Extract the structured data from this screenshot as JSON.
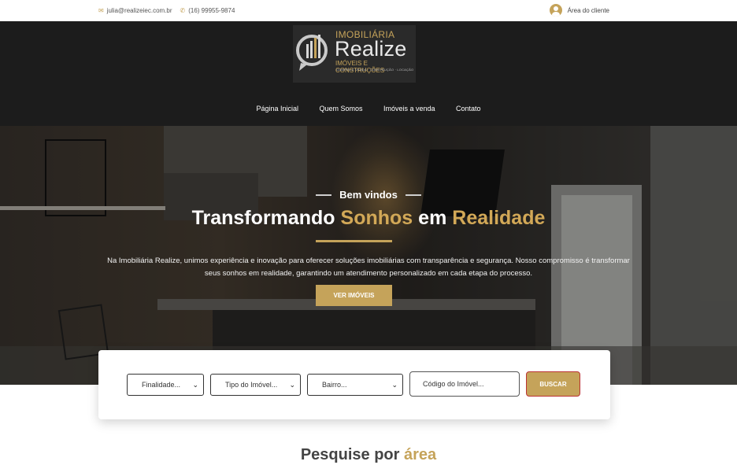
{
  "topbar": {
    "email": "julia@realizeiec.com.br",
    "phone": "(16) 99955-9874",
    "client_area": "Área do cliente"
  },
  "logo": {
    "line1": "IMOBILIÁRIA",
    "line2": "Realize",
    "line3": "IMÓVEIS E CONSTRUÇÕES",
    "line4": "COMPRA E VENDA · CONSTRUÇÃO · LOCAÇÃO"
  },
  "nav": {
    "items": [
      "Página Inicial",
      "Quem Somos",
      "Imóveis a venda",
      "Contato"
    ]
  },
  "hero": {
    "welcome": "Bem vindos",
    "headline_part1": "Transformando",
    "headline_gold1": "Sonhos",
    "headline_part2": "em",
    "headline_gold2": "Realidade",
    "description": "Na Imobiliária Realize, unimos experiência e inovação para oferecer soluções imobiliárias com transparência e segurança. Nosso compromisso é transformar seus sonhos em realidade, garantindo um atendimento personalizado em cada etapa do processo.",
    "cta": "VER IMÓVEIS"
  },
  "search": {
    "finalidade": "Finalidade...",
    "tipo": "Tipo do Imóvel...",
    "bairro": "Bairro...",
    "codigo_placeholder": "Código do Imóvel...",
    "buscar": "BUSCAR"
  },
  "section": {
    "title_part1": "Pesquise por",
    "title_gold": "área"
  },
  "colors": {
    "gold": "#c5a35a",
    "header_bg": "#1c1c1c"
  }
}
